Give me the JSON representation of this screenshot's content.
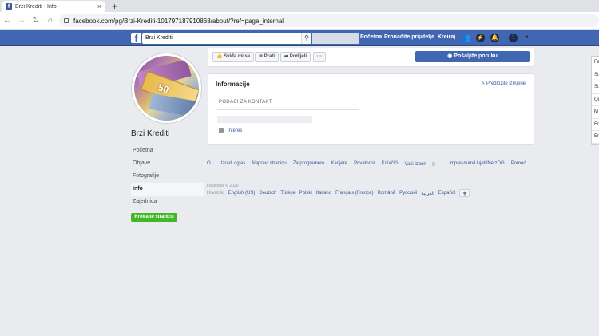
{
  "browser": {
    "tab_title": "Brzi Krediti - Info",
    "tab_favicon": "f",
    "tab_close": "×",
    "new_tab": "+",
    "url": "facebook.com/pg/Brzi-Krediti-101797187910868/about/?ref=page_internal"
  },
  "header": {
    "logo": "f",
    "search_value": "Brzi Krediti",
    "nav": [
      "Početna",
      "Pronađite prijatelje",
      "Kreiraj"
    ]
  },
  "page": {
    "name": "Brzi Krediti",
    "banknote_label": "50"
  },
  "left_nav": [
    {
      "label": "Početna",
      "active": false
    },
    {
      "label": "Objave",
      "active": false
    },
    {
      "label": "Fotografije",
      "active": false
    },
    {
      "label": "Info",
      "active": true
    },
    {
      "label": "Zajednica",
      "active": false
    }
  ],
  "create_page_label": "Kreirajte stranicu",
  "actions": {
    "like": "Sviđa mi se",
    "follow": "Prati",
    "share": "Podijeli",
    "more": "···",
    "send_message": "Pošaljite poruku"
  },
  "info": {
    "title": "Informacije",
    "suggest_edit": "Predložite izmjene",
    "contact_header": "PODACI ZA KONTAKT",
    "category": "Interes"
  },
  "footer": {
    "links": [
      "O...",
      "Izradi oglas",
      "Napravi stranicu",
      "Za programere",
      "Karijere",
      "Privatnost",
      "Kolačići",
      "Vaši izbori",
      "Impressum/Uvjeti/NetzDG",
      "Pomoć"
    ],
    "copyright": "Facebook © 2020",
    "current_lang": "Hrvatski",
    "languages": [
      "English (US)",
      "Deutsch",
      "Türkçe",
      "Polski",
      "Italiano",
      "Français (France)",
      "Română",
      "Русский",
      "العربية",
      "Español"
    ],
    "plus": "+"
  },
  "edge_panel_items": [
    "Fa",
    "St",
    "St",
    "Qu",
    "M",
    "Er",
    "Er"
  ]
}
